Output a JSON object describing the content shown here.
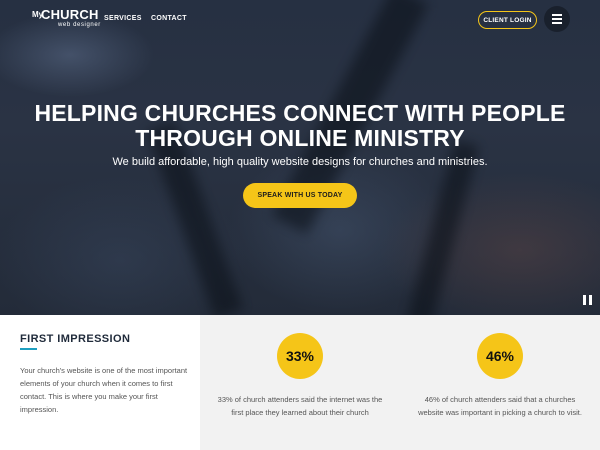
{
  "header": {
    "logo": {
      "my": "My",
      "church": "CHURCH",
      "sub": "web designer"
    },
    "nav": [
      "SERVICES",
      "CONTACT"
    ],
    "client_login": "CLIENT LOGIN",
    "menu_icon": "hamburger-menu-icon"
  },
  "hero": {
    "title_line1": "HELPING CHURCHES CONNECT WITH PEOPLE",
    "title_line2": "THROUGH ONLINE MINISTRY",
    "subtitle": "We build affordable, high quality website designs for churches and ministries.",
    "cta": "SPEAK WITH US TODAY",
    "pause_icon": "pause-icon"
  },
  "first_impression": {
    "title": "FIRST IMPRESSION",
    "body": "Your church's website is one of the most important elements of your church when it comes to first contact. This is where you make your first impression."
  },
  "stats": [
    {
      "value": "33%",
      "text": "33% of church attenders said the internet was the first place they learned about their church"
    },
    {
      "value": "46%",
      "text": "46% of church attenders said that a churches website was important in picking a church to visit."
    }
  ],
  "colors": {
    "accent": "#f5c518",
    "underline": "#1e9fc0",
    "hero_bg": "#263042"
  }
}
